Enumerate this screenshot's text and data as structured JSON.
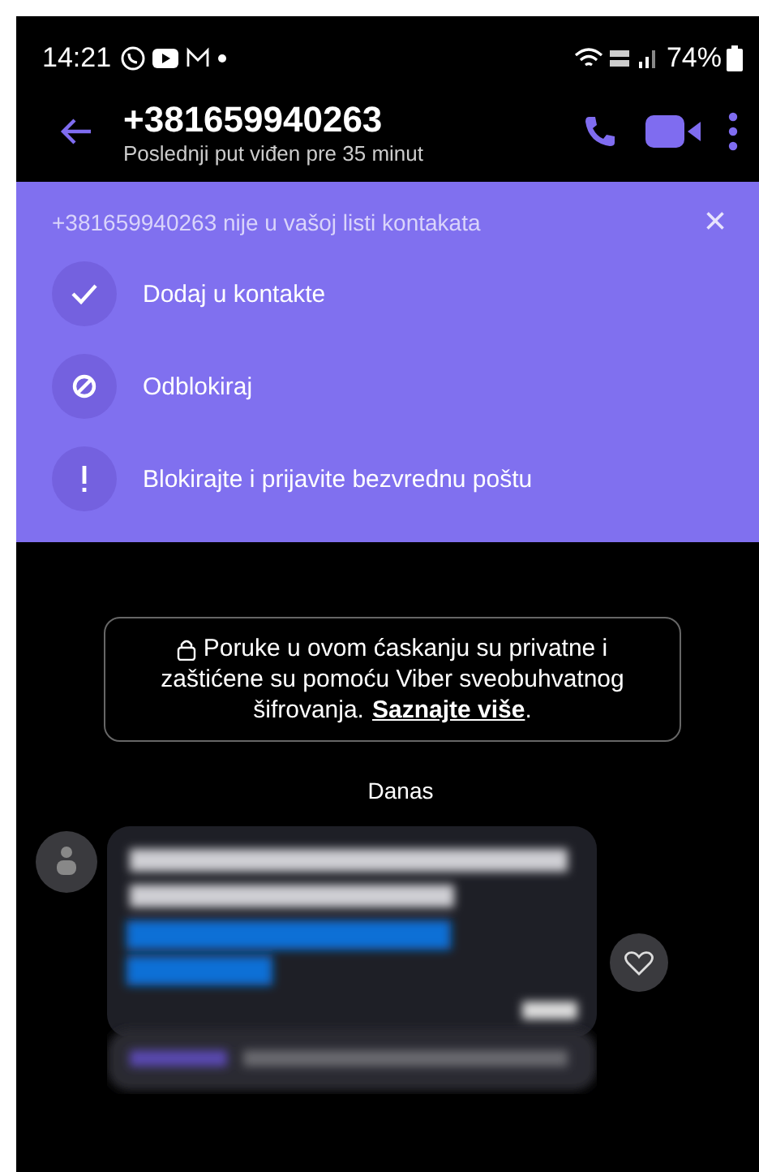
{
  "status_bar": {
    "time": "14:21",
    "battery": "74%"
  },
  "header": {
    "title": "+381659940263",
    "subtitle": "Poslednji put viđen pre 35 minut"
  },
  "banner": {
    "title": "+381659940263 nije u vašoj listi kontakata",
    "close": "×",
    "actions": [
      {
        "kind": "check",
        "label": "Dodaj u kontakte"
      },
      {
        "kind": "unblock",
        "label": "Odblokiraj"
      },
      {
        "kind": "alert",
        "label": "Blokirajte i prijavite bezvrednu poštu"
      }
    ]
  },
  "notice": {
    "first_line": "Poruke u ovom ćaskanju su privatne i",
    "second_line": "zaštićene su pomoću Viber sveobuhvatnog",
    "third_line": "šifrovanja.",
    "link": "Saznajte više",
    "end": "."
  },
  "date_divider": "Danas"
}
